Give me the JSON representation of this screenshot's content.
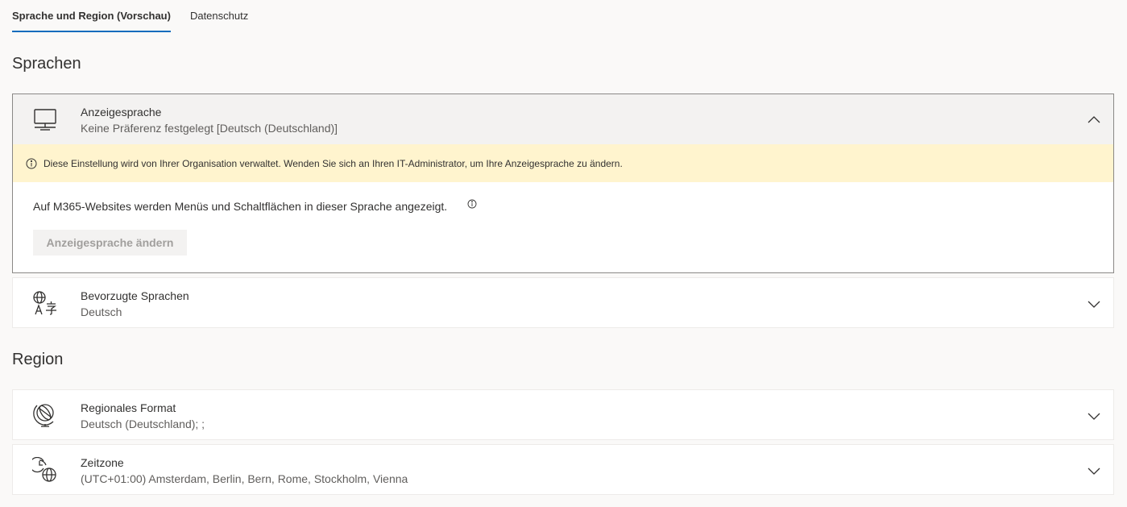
{
  "tabs": [
    {
      "label": "Sprache und Region (Vorschau)",
      "active": true
    },
    {
      "label": "Datenschutz",
      "active": false
    }
  ],
  "sections": {
    "languages": "Sprachen",
    "region": "Region"
  },
  "display_language": {
    "title": "Anzeigesprache",
    "subtitle": "Keine Präferenz festgelegt [Deutsch (Deutschland)]",
    "icon": "monitor-icon",
    "notice": "Diese Einstellung wird von Ihrer Organisation verwaltet. Wenden Sie sich an Ihren IT-Administrator, um Ihre Anzeigesprache zu ändern.",
    "description": "Auf M365-Websites werden Menüs und Schaltflächen in dieser Sprache angezeigt.",
    "change_button": "Anzeigesprache ändern"
  },
  "preferred_languages": {
    "title": "Bevorzugte Sprachen",
    "subtitle": "Deutsch",
    "icon": "language-icon"
  },
  "regional_format": {
    "title": "Regionales Format",
    "subtitle": "Deutsch (Deutschland); ;",
    "icon": "globe-icon"
  },
  "time_zone": {
    "title": "Zeitzone",
    "subtitle": "(UTC+01:00) Amsterdam, Berlin, Bern, Rome, Stockholm, Vienna",
    "icon": "clock-globe-icon"
  },
  "colors": {
    "accent": "#0f6cbd",
    "notice_bg": "#fff4ce",
    "page_bg": "#faf9f8"
  }
}
